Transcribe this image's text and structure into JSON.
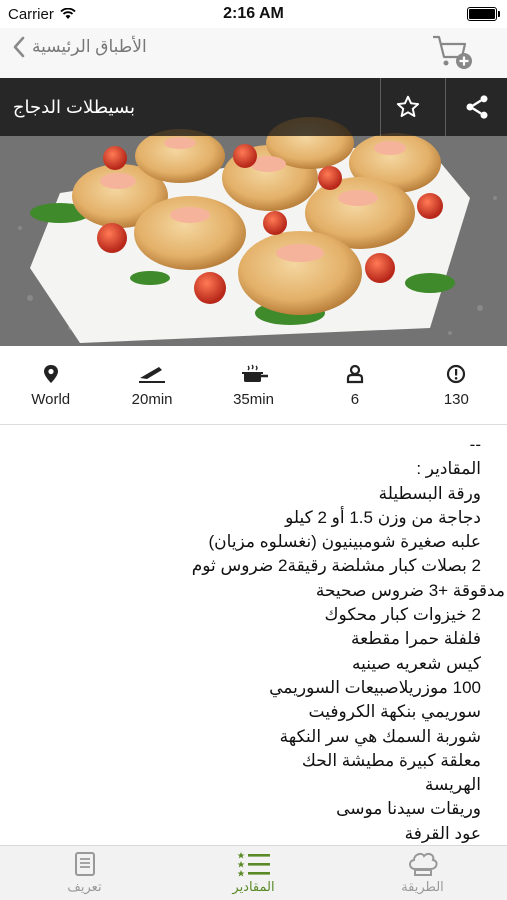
{
  "status_bar": {
    "carrier": "Carrier",
    "time": "2:16 AM"
  },
  "nav": {
    "back_label": "الأطباق الرئيسية"
  },
  "recipe": {
    "title": "بسيطلات الدجاج"
  },
  "stats": [
    {
      "icon": "location-pin-icon",
      "value": "World"
    },
    {
      "icon": "knife-icon",
      "value": "20min"
    },
    {
      "icon": "pot-icon",
      "value": "35min"
    },
    {
      "icon": "person-icon",
      "value": "6"
    },
    {
      "icon": "alert-circle-icon",
      "value": "130"
    }
  ],
  "ingredients_lines": [
    "--",
    "المقادير :",
    "ورقة البسطيلة",
    "دجاجة من وزن 1.5 أو 2 كيلو",
    "علبه صغيرة شومبينيون (نغسلوه مزيان)",
    "2 بصلات كبار مشلضة رقيقة2 ضروس ثوم",
    "مدقوقة +3 ضروس صحيحة",
    "2 خيزوات كبار محكوك",
    "فلفلة حمرا مقطعة",
    "كيس شعريه صينيه",
    "100 موزريلاصبيعات السوريمي",
    "سوريمي بنكهة الكروفيت",
    "شوربة السمك هي سر النكهة",
    "معلقة كبيرة مطيشة الحك",
    "الهريسة",
    "وريقات سيدنا موسى",
    "عود القرفة"
  ],
  "tabs": [
    {
      "label": "تعريف",
      "icon": "document-icon",
      "active": false
    },
    {
      "label": "المقادير",
      "icon": "list-icon",
      "active": true
    },
    {
      "label": "الطريقة",
      "icon": "chef-hat-icon",
      "active": false
    }
  ],
  "colors": {
    "accent": "#5a8a27",
    "inactive": "#999999"
  }
}
